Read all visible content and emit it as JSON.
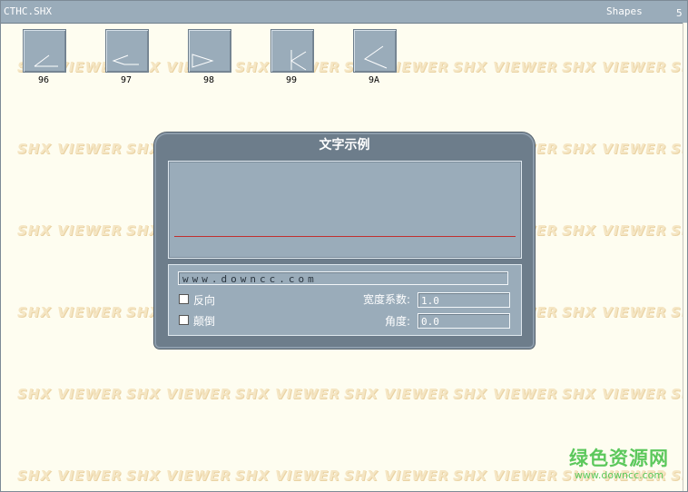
{
  "titlebar": {
    "filename": "CTHC.SHX",
    "label": "Shapes",
    "count": "5"
  },
  "watermark_text": "SHX VIEWER",
  "shapes": [
    {
      "label": "96",
      "glyph": "angle-low"
    },
    {
      "label": "97",
      "glyph": "angle-left-open"
    },
    {
      "label": "98",
      "glyph": "triangle-right"
    },
    {
      "label": "99",
      "glyph": "k-shape"
    },
    {
      "label": "9A",
      "glyph": "less-than"
    }
  ],
  "dialog": {
    "title": "文字示例",
    "text_value": "www.downcc.com",
    "reverse_label": "反向",
    "upside_down_label": "颠倒",
    "reverse_checked": false,
    "upside_down_checked": false,
    "width_factor_label": "宽度系数:",
    "width_factor_value": "1.0",
    "angle_label": "角度:",
    "angle_value": "0.0"
  },
  "logo": {
    "main": "绿色资源网",
    "url": "www.downcc.com"
  },
  "colors": {
    "background": "#fefdf0",
    "panel": "#9aacba",
    "dialog_frame": "#6d7d8b",
    "baseline": "#c03030",
    "watermark": "#f5e6c4",
    "logo": "#5cc85c"
  }
}
